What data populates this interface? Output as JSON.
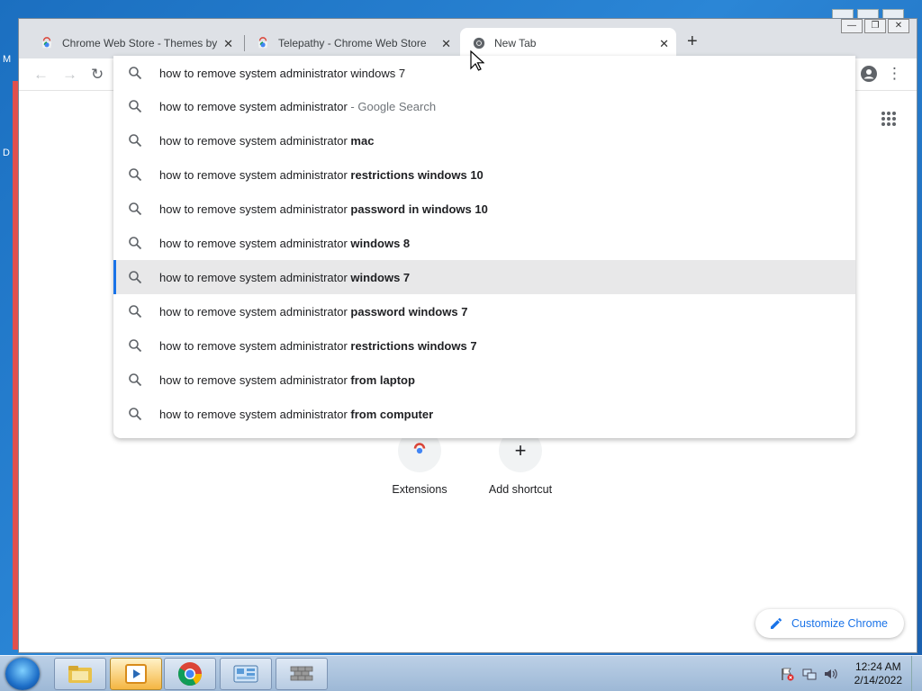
{
  "desktop": {
    "letters": [
      "M",
      "D"
    ]
  },
  "tabs": [
    {
      "title": "Chrome Web Store - Themes by G",
      "active": false
    },
    {
      "title": "Telepathy - Chrome Web Store",
      "active": false
    },
    {
      "title": "New Tab",
      "active": true
    }
  ],
  "omnibox": {
    "suggestions": [
      {
        "prefix": "how to remove system administrator windows 7",
        "suffix": "",
        "style": "plain"
      },
      {
        "prefix": "how to remove system administrator",
        "suffix": " - Google Search",
        "style": "dim"
      },
      {
        "prefix": "how to remove system administrator ",
        "suffix": "mac",
        "style": "bold"
      },
      {
        "prefix": "how to remove system administrator ",
        "suffix": "restrictions windows 10",
        "style": "bold"
      },
      {
        "prefix": "how to remove system administrator ",
        "suffix": "password in windows 10",
        "style": "bold"
      },
      {
        "prefix": "how to remove system administrator ",
        "suffix": "windows 8",
        "style": "bold"
      },
      {
        "prefix": "how to remove system administrator ",
        "suffix": "windows 7",
        "style": "bold",
        "selected": true
      },
      {
        "prefix": "how to remove system administrator ",
        "suffix": "password windows 7",
        "style": "bold"
      },
      {
        "prefix": "how to remove system administrator ",
        "suffix": "restrictions windows 7",
        "style": "bold"
      },
      {
        "prefix": "how to remove system administrator ",
        "suffix": "from laptop",
        "style": "bold"
      },
      {
        "prefix": "how to remove system administrator ",
        "suffix": "from computer",
        "style": "bold"
      }
    ]
  },
  "ntp": {
    "shortcuts": [
      {
        "label": "Extensions"
      },
      {
        "label": "Add shortcut"
      }
    ],
    "customize_label": "Customize Chrome"
  },
  "taskbar": {
    "time": "12:24 AM",
    "date": "2/14/2022"
  },
  "colors": {
    "accent": "#1a73e8",
    "tabstrip": "#dee1e6",
    "selected_row": "#e8e8e9"
  }
}
